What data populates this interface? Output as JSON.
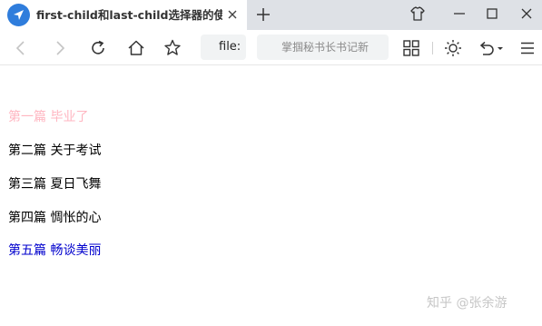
{
  "tab": {
    "title": "first-child和last-child选择器的使"
  },
  "address": {
    "text": "file:"
  },
  "search": {
    "placeholder": "掌掴秘书长书记新"
  },
  "articles": [
    {
      "text": "第一篇 毕业了",
      "color": "#ffb6c1"
    },
    {
      "text": "第二篇 关于考试",
      "color": "#000000"
    },
    {
      "text": "第三篇 夏日飞舞",
      "color": "#000000"
    },
    {
      "text": "第四篇 惆怅的心",
      "color": "#000000"
    },
    {
      "text": "第五篇 畅谈美丽",
      "color": "#0000cd"
    }
  ],
  "watermark": "知乎 @张余游",
  "colors": {
    "tab_bar": "#dee1e6",
    "tab_icon": "#2f7ddc"
  }
}
